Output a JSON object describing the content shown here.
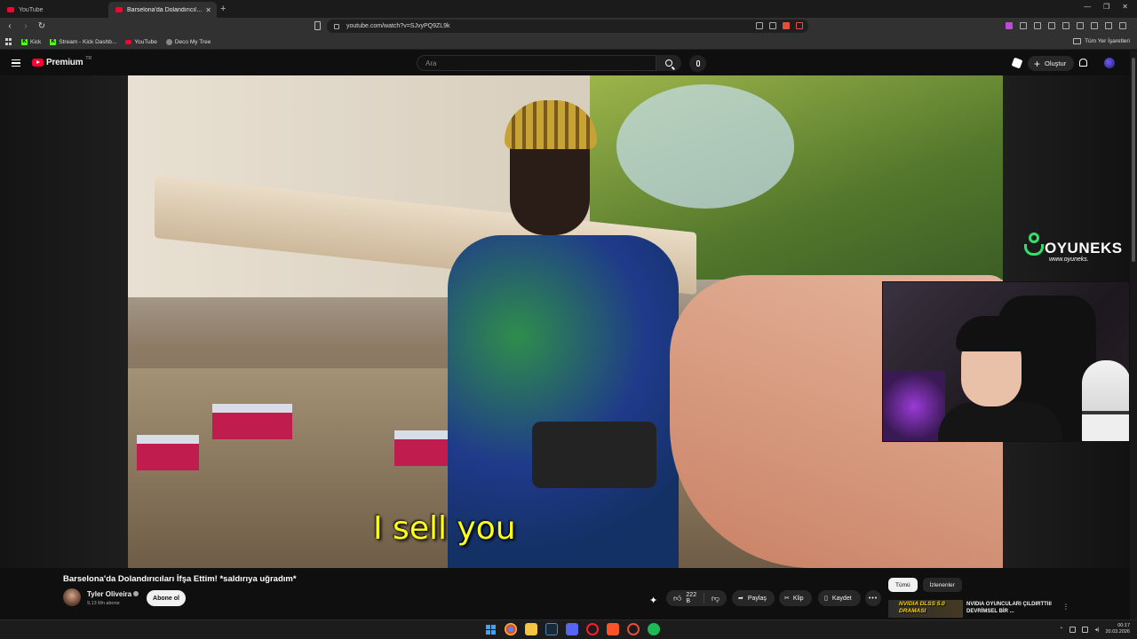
{
  "browser": {
    "tabs": [
      {
        "label": "YouTube",
        "active": false
      },
      {
        "label": "Barselona'da Dolandırıcıları İfşa Ettim! *saldırıya uğradım* - YouTube",
        "active": true
      }
    ],
    "url": "youtube.com/watch?v=SJvyPQ9ZL9k",
    "bookmarks": [
      {
        "label": "Kick",
        "icon": "kick-icon"
      },
      {
        "label": "Stream - Kick Dashb...",
        "icon": "kick-icon"
      },
      {
        "label": "YouTube",
        "icon": "youtube-icon"
      },
      {
        "label": "Deco My Tree",
        "icon": "deco-icon"
      }
    ],
    "all_bookmarks_label": "Tüm Yer İşaretleri"
  },
  "masthead": {
    "logo_text": "Premium",
    "logo_region": "TR",
    "search_placeholder": "Ara",
    "create_label": "Oluştur"
  },
  "player": {
    "subtitle": "I sell you",
    "brand_name": "OYUNEKS",
    "brand_site": "www.oyuneks."
  },
  "video": {
    "title": "Barselona'da Dolandırıcıları İfşa Ettim! *saldırıya uğradım*",
    "channel_name": "Tyler Oliveira",
    "subscribers": "9,13 Mn abone",
    "subscribe_label": "Abone ol",
    "likes": "222 B",
    "share_label": "Paylaş",
    "clip_label": "Klip",
    "save_label": "Kaydet"
  },
  "sidebar": {
    "chips": [
      {
        "label": "Tümü",
        "active": true
      },
      {
        "label": "İzlenenler",
        "active": false
      }
    ],
    "recommendation": {
      "thumb_text": "NVIDIA DLSS 5.0 DRAMASI",
      "title": "NVIDIA OYUNCULARI ÇILDIRTTIII DEVRİMSEL BİR ..."
    }
  },
  "taskbar": {
    "time": "00:17",
    "date": "20.03.2026"
  },
  "colors": {
    "youtube_red": "#ff0033",
    "subtitle_yellow": "#ffff1a",
    "oyuneks_green": "#35e06a",
    "kick_green": "#53fc18"
  }
}
